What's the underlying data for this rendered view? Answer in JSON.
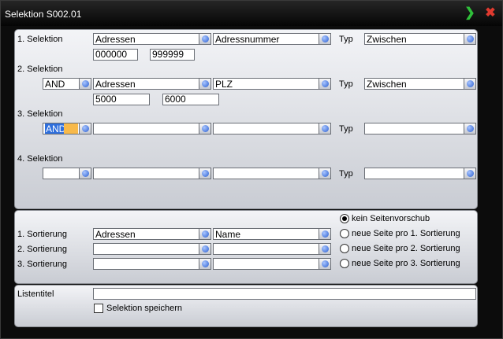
{
  "window": {
    "title": "Selektion S002.01"
  },
  "selections": [
    {
      "label": "1. Selektion",
      "operator": "",
      "table": "Adressen",
      "field": "Adressnummer",
      "type_label": "Typ",
      "type": "Zwischen",
      "from": "000000",
      "to": "999999"
    },
    {
      "label": "2. Selektion",
      "operator": "AND",
      "table": "Adressen",
      "field": "PLZ",
      "type_label": "Typ",
      "type": "Zwischen",
      "from": "5000",
      "to": "6000"
    },
    {
      "label": "3. Selektion",
      "operator": "AND",
      "table": "",
      "field": "",
      "type_label": "Typ",
      "type": ""
    },
    {
      "label": "4. Selektion",
      "operator": "",
      "table": "",
      "field": "",
      "type_label": "Typ",
      "type": ""
    }
  ],
  "sortings": [
    {
      "label": "1. Sortierung",
      "table": "Adressen",
      "field": "Name"
    },
    {
      "label": "2. Sortierung",
      "table": "",
      "field": ""
    },
    {
      "label": "3. Sortierung",
      "table": "",
      "field": ""
    }
  ],
  "page_break": {
    "options": [
      "kein Seitenvorschub",
      "neue Seite pro 1. Sortierung",
      "neue Seite pro 2. Sortierung",
      "neue Seite pro 3. Sortierung"
    ],
    "selected_index": 0
  },
  "list_title": {
    "label": "Listentitel",
    "value": ""
  },
  "save_selection": {
    "label": "Selektion speichern",
    "checked": false
  },
  "colors": {
    "accent_ok": "#2fbf3a",
    "accent_close": "#e03a2f",
    "selection_highlight": "#2f6fdc"
  },
  "icons": {
    "ok": "check-arrow-icon",
    "close": "close-icon",
    "dropdown": "dropdown-orb-icon"
  }
}
